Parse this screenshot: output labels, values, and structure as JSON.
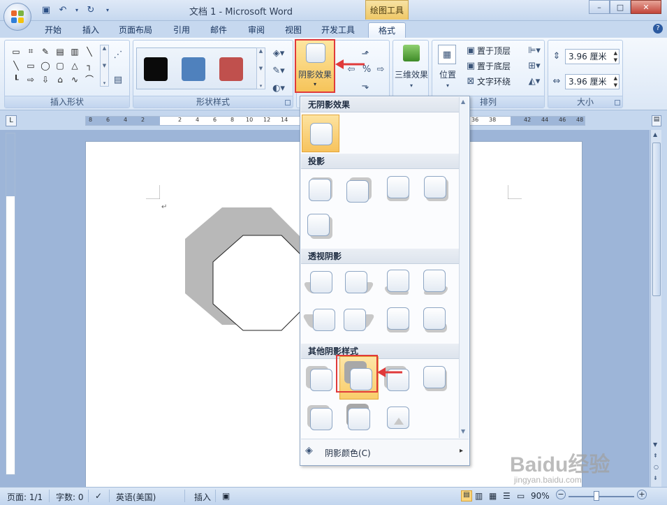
{
  "window": {
    "title": "文档 1 - Microsoft Word",
    "contextual_tab_group": "绘图工具",
    "minimize": "–",
    "maximize": "□",
    "close": "✕",
    "help": "?"
  },
  "tabs": [
    "开始",
    "插入",
    "页面布局",
    "引用",
    "邮件",
    "审阅",
    "视图",
    "开发工具",
    "格式"
  ],
  "active_tab": "格式",
  "ribbon": {
    "groups": {
      "insert_shapes": "插入形状",
      "shape_styles": "形状样式",
      "arrange": "排列",
      "size": "大小"
    },
    "shadow_effects_button": "阴影效果",
    "three_d_effects_button": "三维效果",
    "position_button": "位置",
    "bring_to_front": "置于顶层",
    "send_to_back": "置于底层",
    "text_wrapping": "文字环绕",
    "height_value": "3.96 厘米",
    "width_value": "3.96 厘米",
    "style_swatch_colors": [
      "#0a0a0a",
      "#4f81bd",
      "#c0504d"
    ]
  },
  "ruler": {
    "ticks_left": [
      "8",
      "6",
      "4",
      "2"
    ],
    "ticks_right": [
      "2",
      "4",
      "6",
      "8",
      "10",
      "12",
      "14"
    ],
    "ticks_far_right": [
      "36",
      "38",
      "42",
      "44",
      "46",
      "48"
    ]
  },
  "dropdown": {
    "sections": [
      "无阴影效果",
      "投影",
      "透视阴影",
      "其他阴影样式"
    ],
    "footer_label": "阴影颜色(C)",
    "footer_arrow": "▸"
  },
  "statusbar": {
    "page": "页面: 1/1",
    "words": "字数: 0",
    "language": "英语(美国)",
    "mode": "插入",
    "zoom": "90%"
  },
  "watermark": {
    "main": "Baidu经验",
    "sub": "jingyan.baidu.com"
  },
  "colors": {
    "highlight": "#f7c35d",
    "callout_red": "#e03a3a",
    "octagon_shadow": "#b8b8b8"
  }
}
